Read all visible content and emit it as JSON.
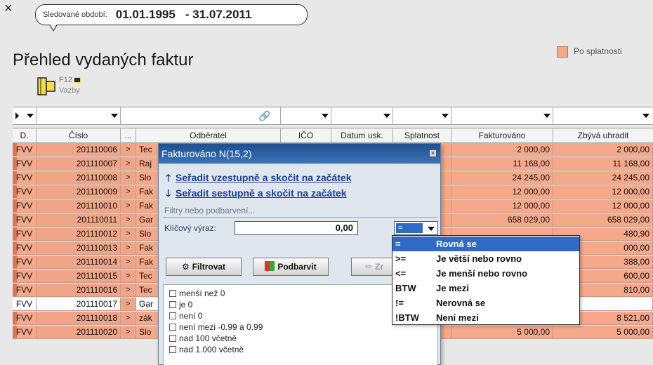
{
  "window": {
    "close_label": "×"
  },
  "period": {
    "label": "Sledované období:",
    "from": "01.01.1995",
    "to": "- 31.07.2011"
  },
  "page_title": "Přehled vydaných faktur",
  "legend": {
    "label": "Po splatnosti",
    "color": "#f5a98a"
  },
  "shortcut": {
    "key": "F12",
    "label": "Vazby"
  },
  "columns": [
    "D.",
    "Číslo",
    "...",
    "Odběratel",
    "IČO",
    "Datum usk.",
    "Splatnost",
    "Fakturováno",
    "Zbývá uhradit"
  ],
  "rows": [
    {
      "d": "FVV",
      "cislo": "201110006",
      "odberatel": "Tec",
      "fakturovano": "2 000,00",
      "zbyva": "2 000,00",
      "overdue": true
    },
    {
      "d": "FVV",
      "cislo": "201110007",
      "odberatel": "Raj",
      "fakturovano": "11 168,00",
      "zbyva": "11 168,00",
      "overdue": true
    },
    {
      "d": "FVV",
      "cislo": "201110008",
      "odberatel": "Slo",
      "fakturovano": "24 245,00",
      "zbyva": "24 245,00",
      "overdue": true
    },
    {
      "d": "FVV",
      "cislo": "201110009",
      "odberatel": "Fak",
      "fakturovano": "12 000,00",
      "zbyva": "12 000,00",
      "overdue": true
    },
    {
      "d": "FVV",
      "cislo": "201110010",
      "odberatel": "Fak",
      "fakturovano": "12 000,00",
      "zbyva": "12 000,00",
      "overdue": true
    },
    {
      "d": "FVV",
      "cislo": "201110011",
      "odberatel": "Gar",
      "fakturovano": "658 029,00",
      "zbyva": "658 029,00",
      "overdue": true
    },
    {
      "d": "FVV",
      "cislo": "201110012",
      "odberatel": "Slo",
      "fakturovano": "",
      "zbyva": "480,90",
      "overdue": true
    },
    {
      "d": "FVV",
      "cislo": "201110013",
      "odberatel": "Fak",
      "fakturovano": "",
      "zbyva": "000,00",
      "overdue": true
    },
    {
      "d": "FVV",
      "cislo": "201110014",
      "odberatel": "Fak",
      "fakturovano": "",
      "zbyva": "388,00",
      "overdue": true
    },
    {
      "d": "FVV",
      "cislo": "201110015",
      "odberatel": "Tec",
      "fakturovano": "",
      "zbyva": "600,00",
      "overdue": true
    },
    {
      "d": "FVV",
      "cislo": "201110016",
      "odberatel": "Tec",
      "fakturovano": "",
      "zbyva": "810,00",
      "overdue": true
    },
    {
      "d": "FVV",
      "cislo": "201110017",
      "odberatel": "Gar",
      "fakturovano": "",
      "zbyva": "",
      "overdue": false
    },
    {
      "d": "FVV",
      "cislo": "201110018",
      "odberatel": "zák",
      "fakturovano": "8 521,00",
      "zbyva": "8 521,00",
      "overdue": true
    },
    {
      "d": "FVV",
      "cislo": "201110020",
      "odberatel": "Slo",
      "fakturovano": "5 000,00",
      "zbyva": "5 000,00",
      "overdue": true
    }
  ],
  "popup": {
    "title": "Fakturováno N(15,2)",
    "sort_asc": "Seřadit vzestupně a skočit na začátek",
    "sort_desc": "Seřadit sestupně a skočit na začátek",
    "filters_label": "Filtry nebo podbarvení...",
    "key_label": "Klíčový výraz:",
    "key_value": "0,00",
    "operator_value": "=",
    "btn_filter": "Filtrovat",
    "btn_color": "Podbarvit",
    "btn_cancel": "Zr",
    "checklist": [
      "menší než 0",
      "je 0",
      "není 0",
      "není mezi -0.99 a 0.99",
      "nad 100 včetně",
      "nad 1.000 včetně"
    ]
  },
  "operators": [
    {
      "sym": "=",
      "desc": "Rovná se",
      "selected": true
    },
    {
      "sym": ">=",
      "desc": "Je větší nebo rovno",
      "selected": false
    },
    {
      "sym": "<=",
      "desc": "Je menší nebo rovno",
      "selected": false
    },
    {
      "sym": "BTW",
      "desc": "Je mezi",
      "selected": false
    },
    {
      "sym": "!=",
      "desc": "Nerovná se",
      "selected": false
    },
    {
      "sym": "!BTW",
      "desc": "Není mezi",
      "selected": false
    }
  ]
}
